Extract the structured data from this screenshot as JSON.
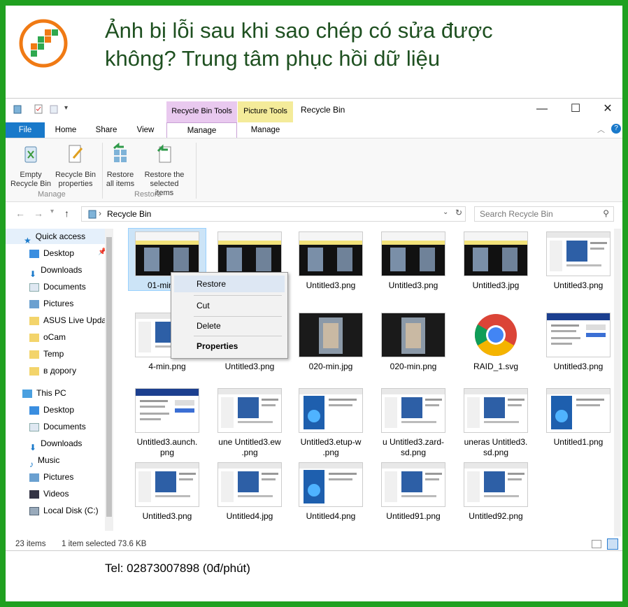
{
  "banner": {
    "headline_line1": "Ảnh bị lỗi sau khi sao chép có sửa được",
    "headline_line2": "không? Trung tâm phục hồi dữ liệu",
    "tel": "Tel: 02873007898 (0đ/phút)"
  },
  "window": {
    "title": "Recycle Bin",
    "context_tab_group1": "Recycle Bin Tools",
    "context_tab_group2": "Picture Tools",
    "minimize": "—",
    "maximize": "☐",
    "close": "✕"
  },
  "tabs": {
    "file": "File",
    "home": "Home",
    "share": "Share",
    "view": "View",
    "manage1": "Manage",
    "manage2": "Manage"
  },
  "ribbon": {
    "empty_line1": "Empty",
    "empty_line2": "Recycle Bin",
    "props_line1": "Recycle Bin",
    "props_line2": "properties",
    "restore_all_line1": "Restore",
    "restore_all_line2": "all items",
    "restore_sel_line1": "Restore the",
    "restore_sel_line2": "selected items",
    "group_manage": "Manage",
    "group_restore": "Restore"
  },
  "address": {
    "path": "Recycle Bin",
    "search_placeholder": "Search Recycle Bin"
  },
  "nav": {
    "quick_access": "Quick access",
    "desktop": "Desktop",
    "downloads": "Downloads",
    "documents": "Documents",
    "pictures": "Pictures",
    "asus": "ASUS Live Updat",
    "ocam": "oCam",
    "temp": "Temp",
    "vdorogu": "в дорогу",
    "this_pc": "This PC",
    "pc_desktop": "Desktop",
    "pc_documents": "Documents",
    "pc_downloads": "Downloads",
    "pc_music": "Music",
    "pc_pictures": "Pictures",
    "pc_videos": "Videos",
    "pc_local": "Local Disk (C:)"
  },
  "files": [
    {
      "name": "01-min.jpg",
      "kind": "dark"
    },
    {
      "name": "",
      "kind": "dark"
    },
    {
      "name": "Untitled3.png",
      "kind": "dark"
    },
    {
      "name": "Untitled3.png",
      "kind": "dark"
    },
    {
      "name": "Untitled3.jpg",
      "kind": "dark"
    },
    {
      "name": "Untitled3.png",
      "kind": "doc"
    },
    {
      "name": "4-min.png",
      "kind": "doc"
    },
    {
      "name": "Untitled3.png",
      "kind": "doc"
    },
    {
      "name": "020-min.jpg",
      "kind": "photo"
    },
    {
      "name": "020-min.png",
      "kind": "photo"
    },
    {
      "name": "RAID_1.svg",
      "kind": "chrome"
    },
    {
      "name": "Untitled3.png",
      "kind": "web"
    },
    {
      "name": "Untitled3.aunch.\npng",
      "kind": "web"
    },
    {
      "name": "une Untitled3.ew\n.png",
      "kind": "doc"
    },
    {
      "name": "Untitled3.etup-w\n.png",
      "kind": "blue"
    },
    {
      "name": "u Untitled3.zard-\nsd.png",
      "kind": "doc"
    },
    {
      "name": "uneras Untitled3.\nsd.png",
      "kind": "doc"
    },
    {
      "name": "Untitled1.png",
      "kind": "blue"
    },
    {
      "name": "Untitled3.png",
      "kind": "doc"
    },
    {
      "name": "Untitled4.jpg",
      "kind": "doc"
    },
    {
      "name": "Untitled4.png",
      "kind": "blue"
    },
    {
      "name": "Untitled91.png",
      "kind": "doc"
    },
    {
      "name": "Untitled92.png",
      "kind": "doc"
    }
  ],
  "context_menu": {
    "restore": "Restore",
    "cut": "Cut",
    "delete": "Delete",
    "properties": "Properties"
  },
  "status": {
    "count": "23 items",
    "selected": "1 item selected  73.6 KB"
  },
  "colors": {
    "frame_green": "#20a020",
    "headline": "#1e5020",
    "file_tab": "#1979ca",
    "recycle_tools": "#e9c9ef",
    "picture_tools": "#f4eb9a"
  }
}
